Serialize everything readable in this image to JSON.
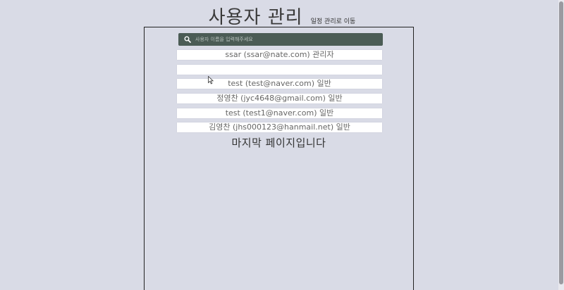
{
  "header": {
    "title": "사용자 관리",
    "schedule_link": "일정 관리로 이동"
  },
  "search": {
    "placeholder": "사용자 이름을 입력해주세요",
    "icon": "search-icon"
  },
  "users": [
    {
      "text": "ssar (ssar@nate.com) 관리자"
    },
    {
      "text": ""
    },
    {
      "text": "test (test@naver.com) 일반"
    },
    {
      "text": "정영찬 (jyc4648@gmail.com) 일반"
    },
    {
      "text": "test (test1@naver.com) 일반"
    },
    {
      "text": "김영찬 (jhs000123@hanmail.net) 일반"
    }
  ],
  "pagination": {
    "last_page_message": "마지막 페이지입니다"
  },
  "colors": {
    "background": "#d9dbe6",
    "search_bar": "#4b5c55"
  }
}
